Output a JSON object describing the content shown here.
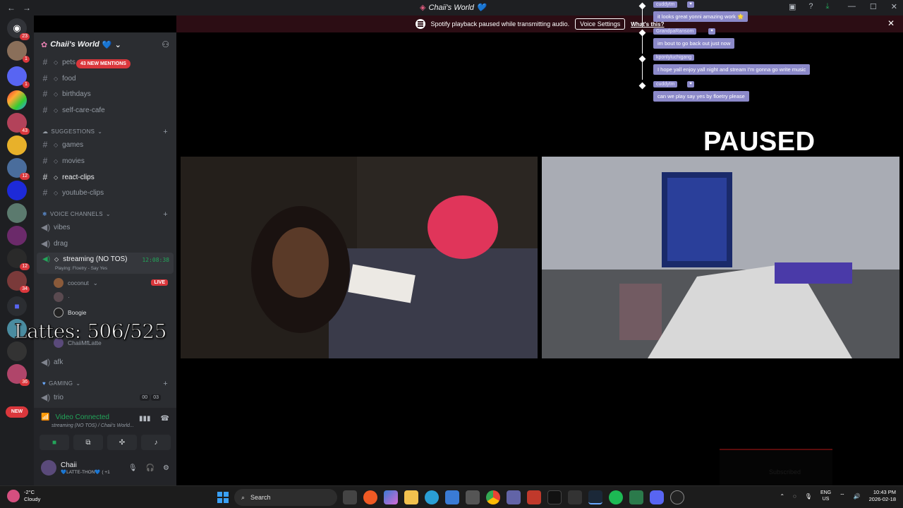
{
  "window": {
    "title": "Chaii's World 💙",
    "back_icon": "←",
    "forward_icon": "→",
    "minimize": "—",
    "maximize": "☐",
    "close": "✕"
  },
  "banner": {
    "text": "Spotify playback paused while transmitting audio.",
    "button": "Voice Settings",
    "link": "What's this?",
    "close": "✕"
  },
  "rail": {
    "badges": [
      "23",
      "1",
      "1",
      "43",
      "12",
      "12",
      "34",
      "36"
    ],
    "new_pill": "NEW"
  },
  "server": {
    "name": "Chaii's World",
    "heart": "💙",
    "chevron": "⌄",
    "mentions": "43 NEW MENTIONS"
  },
  "channels": {
    "text_top": [
      {
        "name": "pets"
      },
      {
        "name": "food"
      },
      {
        "name": "birthdays"
      },
      {
        "name": "self-care-cafe"
      }
    ],
    "suggestions_label": "SUGGESTIONS",
    "suggestions": [
      {
        "name": "games"
      },
      {
        "name": "movies"
      },
      {
        "name": "react-clips"
      },
      {
        "name": "youtube-clips"
      }
    ],
    "voice_label": "VOICE CHANNELS",
    "voice": [
      {
        "name": "vibes"
      },
      {
        "name": "drag"
      }
    ],
    "active_voice": {
      "name": "streaming (NO TOS)",
      "sub": "Playing: Floetry - Say Yes",
      "time": "12:08:38"
    },
    "voice_users": [
      {
        "name": "coconut"
      },
      {
        "name": "·"
      },
      {
        "name": "Boogie"
      },
      {
        "name": "ChaiiMfLatte"
      }
    ],
    "live_badge": "LIVE",
    "after_voice": [
      {
        "name": "afk"
      }
    ],
    "gaming_label": "GAMING",
    "gaming": [
      {
        "name": "trio",
        "count_a": "00",
        "count_b": "03"
      }
    ]
  },
  "overlay": {
    "lattes": "Lattes: 506/525",
    "paused": "PAUSED",
    "subscribed": "Subscribed"
  },
  "voice_panel": {
    "status": "Video Connected",
    "sub": "streaming (NO TOS) / Chaii's World...",
    "user_name": "Chaii",
    "user_status": "💙LATTE-THON💙 ( +1"
  },
  "chat": [
    {
      "user": "cuddytm",
      "text": "it looks great yonni amazing work 🌟"
    },
    {
      "user": "GrandpaRansom",
      "text": "im bout to go back out just now"
    },
    {
      "user": "kponlyluchigang",
      "text": "I hope yall enjoy yall night and stream I'm gonna go write music"
    },
    {
      "user": "cuddytm",
      "text": "can we play say yes by floetry please"
    }
  ],
  "taskbar": {
    "temp": "-2°C",
    "weather": "Cloudy",
    "search": "Search",
    "lang1": "ENG",
    "lang2": "US",
    "time": "10:43 PM",
    "date": "2026-02-18"
  },
  "colors": {
    "rail_bg": "#1e1f22",
    "sidebar_bg": "#2b2d31",
    "banner_bg": "#2c0d14",
    "chat_bubble": "#8b89c9",
    "green": "#23a55a",
    "red": "#da373c"
  }
}
